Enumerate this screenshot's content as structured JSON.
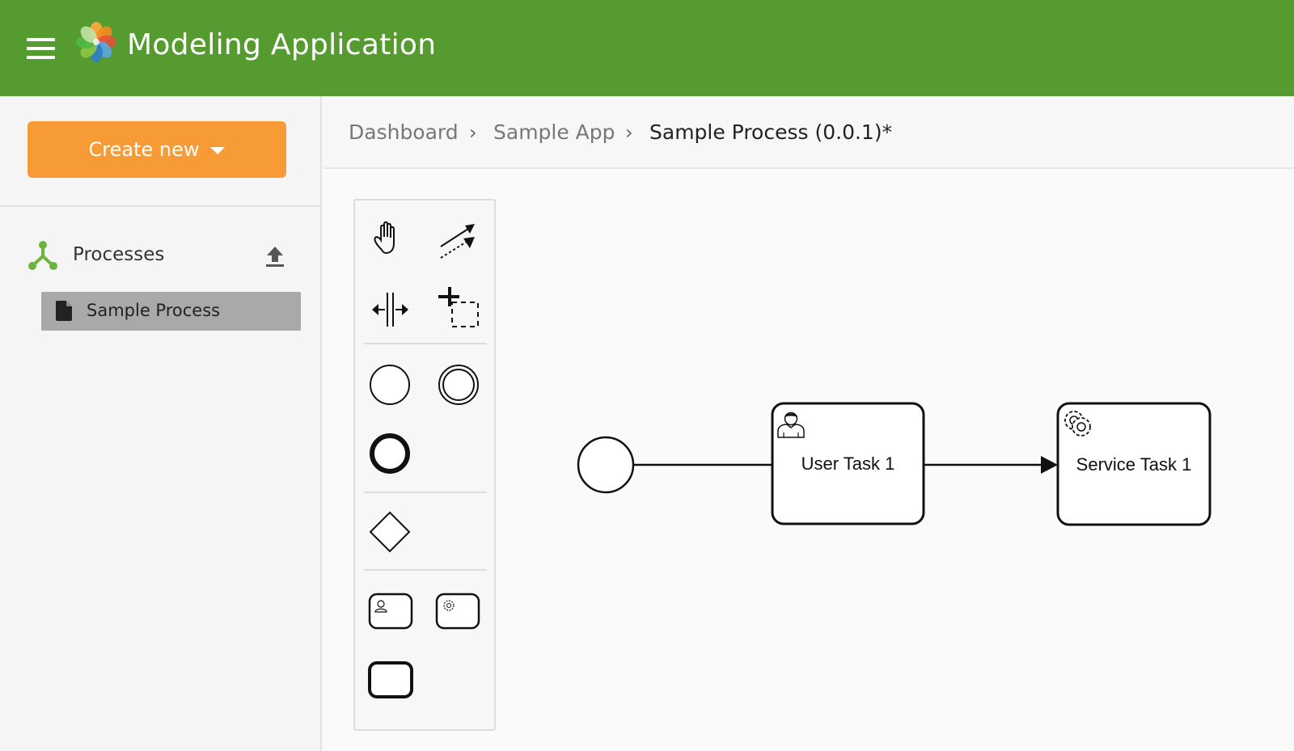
{
  "header": {
    "title": "Modeling Application",
    "bg_color": "#559b2f",
    "menu_icon": "hamburger-menu-icon",
    "logo_icon": "alfresco-logo-icon"
  },
  "sidebar": {
    "create_button": {
      "label": "Create new",
      "color": "#f69b36"
    },
    "section": {
      "label": "Processes",
      "icon": "processes-icon",
      "action_icon": "upload-icon"
    },
    "items": [
      {
        "label": "Sample Process",
        "icon": "document-icon"
      }
    ]
  },
  "breadcrumb": {
    "items": [
      "Dashboard",
      "Sample App"
    ],
    "current": "Sample Process (0.0.1)*"
  },
  "palette": {
    "tools": [
      "hand-tool-icon",
      "global-connect-tool-icon",
      "space-tool-icon",
      "lasso-tool-icon",
      "start-event-icon",
      "intermediate-event-icon",
      "end-event-icon",
      "exclusive-gateway-icon",
      "user-task-icon",
      "service-task-icon",
      "task-icon"
    ]
  },
  "diagram": {
    "start_event": "start-event",
    "tasks": [
      {
        "label": "User Task 1",
        "type": "user-task"
      },
      {
        "label": "Service Task 1",
        "type": "service-task"
      }
    ]
  }
}
